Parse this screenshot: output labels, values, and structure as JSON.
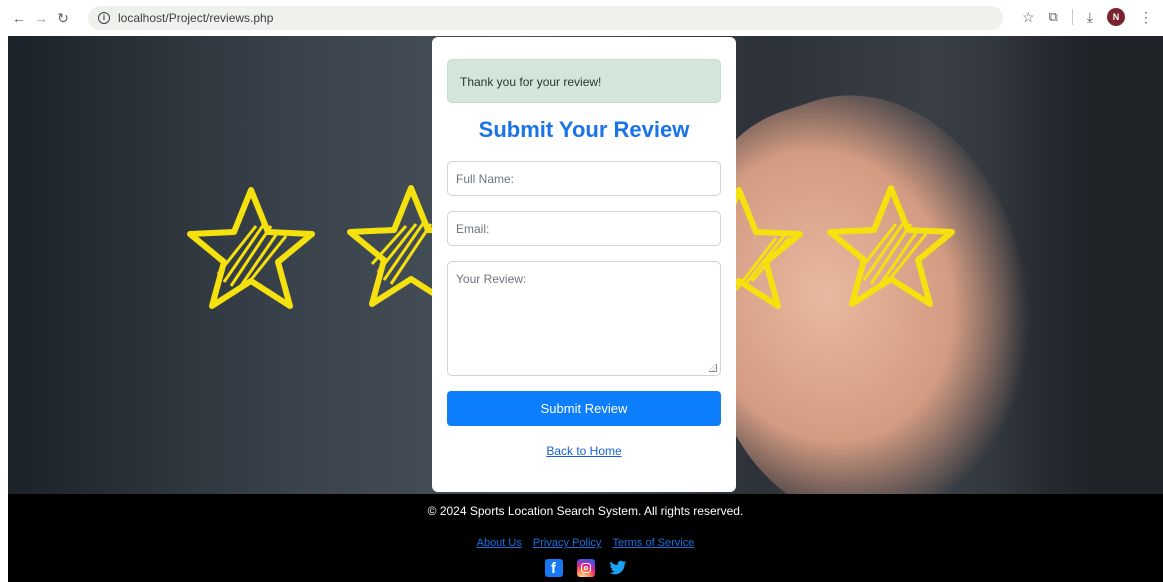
{
  "browser": {
    "url": "localhost/Project/reviews.php",
    "icons": [
      "back-arrow-icon",
      "forward-arrow-icon",
      "reload-icon",
      "site-info-icon",
      "bookmark-star-icon",
      "extensions-icon",
      "download-icon",
      "profile-avatar",
      "menu-dots-icon"
    ],
    "avatar_letter": "N"
  },
  "alert": {
    "text": "Thank you for your review!"
  },
  "form": {
    "title": "Submit Your Review",
    "name_placeholder": "Full Name:",
    "email_placeholder": "Email:",
    "review_placeholder": "Your Review:",
    "submit_label": "Submit Review",
    "back_link": "Back to Home"
  },
  "footer": {
    "copyright": "© 2024 Sports Location Search System. All rights reserved.",
    "links": [
      "About Us",
      "Privacy Policy",
      "Terms of Service"
    ],
    "socials": [
      "facebook-icon",
      "instagram-icon",
      "twitter-icon"
    ]
  },
  "colors": {
    "accent": "#0d7efc",
    "title": "#1a73e8",
    "alert_bg": "#d4e6dc",
    "star": "#f5e10e",
    "footer_bg": "#000000"
  }
}
